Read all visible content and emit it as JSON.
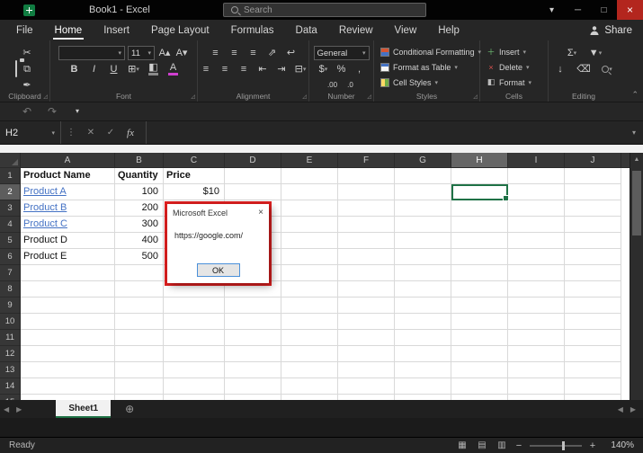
{
  "titlebar": {
    "title": "Book1  -  Excel",
    "search_placeholder": "Search"
  },
  "ribbon_tabs": {
    "items": [
      {
        "label": "File",
        "active": false
      },
      {
        "label": "Home",
        "active": true
      },
      {
        "label": "Insert",
        "active": false
      },
      {
        "label": "Page Layout",
        "active": false
      },
      {
        "label": "Formulas",
        "active": false
      },
      {
        "label": "Data",
        "active": false
      },
      {
        "label": "Review",
        "active": false
      },
      {
        "label": "View",
        "active": false
      },
      {
        "label": "Help",
        "active": false
      }
    ],
    "share_label": "Share"
  },
  "ribbon": {
    "font_size": "11",
    "number_format": "General",
    "bold_label": "B",
    "italic_label": "I",
    "underline_label": "U",
    "autosum_label": "Σ",
    "styles_buttons": [
      "Conditional Formatting",
      "Format as Table",
      "Cell Styles"
    ],
    "cells_buttons": [
      "Insert",
      "Delete",
      "Format"
    ],
    "group_labels": [
      "Clipboard",
      "Font",
      "Alignment",
      "Number",
      "Styles",
      "Cells",
      "Editing"
    ]
  },
  "formula_bar": {
    "name_box": "H2",
    "fx_label": "fx",
    "formula": ""
  },
  "grid": {
    "columns": [
      "A",
      "B",
      "C",
      "D",
      "E",
      "F",
      "G",
      "H",
      "I",
      "J"
    ],
    "row_count": 15,
    "selected_cell": "H2",
    "selected_column": "H",
    "selected_row": 2,
    "cells": {
      "A1": {
        "text": "Product Name",
        "bold": true
      },
      "B1": {
        "text": "Quantity",
        "bold": true
      },
      "C1": {
        "text": "Price",
        "bold": true
      },
      "A2": {
        "text": "Product A",
        "link": true
      },
      "B2": {
        "text": "100",
        "align": "right"
      },
      "C2": {
        "text": "$10",
        "align": "right"
      },
      "A3": {
        "text": "Product B",
        "link": true
      },
      "B3": {
        "text": "200",
        "align": "right"
      },
      "A4": {
        "text": "Product C",
        "link": true
      },
      "B4": {
        "text": "300",
        "align": "right"
      },
      "A5": {
        "text": "Product D"
      },
      "B5": {
        "text": "400",
        "align": "right"
      },
      "A6": {
        "text": "Product E"
      },
      "B6": {
        "text": "500",
        "align": "right"
      }
    }
  },
  "dialog": {
    "title": "Microsoft Excel",
    "message": "https://google.com/",
    "ok_label": "OK",
    "close_label": "×"
  },
  "sheet_tabs": {
    "active": "Sheet1"
  },
  "status_bar": {
    "status": "Ready",
    "zoom": "140%"
  }
}
